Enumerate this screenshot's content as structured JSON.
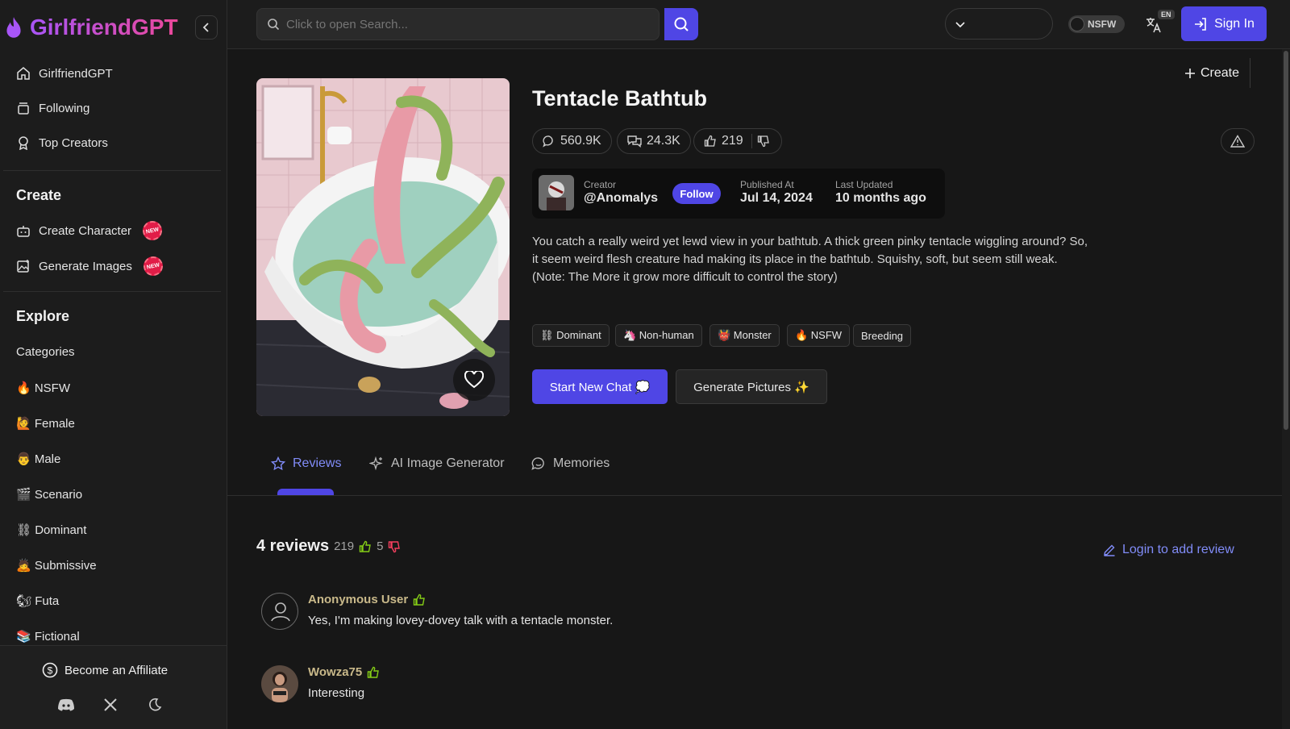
{
  "app": {
    "brand": "GirlfriendGPT"
  },
  "sidebar": {
    "nav": [
      {
        "label": "GirlfriendGPT",
        "icon": "home-icon"
      },
      {
        "label": "Following",
        "icon": "stack-icon"
      },
      {
        "label": "Top Creators",
        "icon": "award-icon"
      }
    ],
    "create_title": "Create",
    "create_items": [
      {
        "label": "Create Character",
        "badge": "NEW",
        "icon": "bot-icon"
      },
      {
        "label": "Generate Images",
        "badge": "NEW",
        "icon": "image-plus-icon"
      }
    ],
    "explore_title": "Explore",
    "explore_items": [
      {
        "label": "Categories"
      },
      {
        "label": "🔥 NSFW"
      },
      {
        "label": "🙋 Female"
      },
      {
        "label": "👨 Male"
      },
      {
        "label": "🎬 Scenario"
      },
      {
        "label": "⛓ Dominant"
      },
      {
        "label": "🙇 Submissive"
      },
      {
        "label": "🐿 Futa"
      },
      {
        "label": "📚 Fictional"
      }
    ],
    "affiliate_label": "Become an Affiliate",
    "social_icons": [
      "discord-icon",
      "x-icon",
      "moon-icon"
    ]
  },
  "topbar": {
    "search_placeholder": "Click to open Search...",
    "create_label": "Create",
    "nsfw_label": "NSFW",
    "lang_badge": "EN",
    "signin_label": "Sign In"
  },
  "character": {
    "title": "Tentacle Bathtub",
    "stats": {
      "chats": "560.9K",
      "messages": "24.3K",
      "likes": "219"
    },
    "creator_label": "Creator",
    "creator_name": "@Anomalys",
    "follow_label": "Follow",
    "published_label": "Published At",
    "published_value": "Jul 14, 2024",
    "updated_label": "Last Updated",
    "updated_value": "10 months ago",
    "description": "You catch a really weird yet lewd view in your bathtub. A thick green pinky tentacle wiggling around? So, it seem weird flesh creature had making its place in the bathtub. Squishy, soft, but seem still weak. (Note: The More it grow more difficult to control the story)",
    "tags": [
      "⛓ Dominant",
      "🦄 Non-human",
      "👹 Monster",
      "🔥 NSFW",
      "Breeding"
    ],
    "start_chat_label": "Start New Chat 💭",
    "generate_label": "Generate Pictures ✨"
  },
  "tabs": [
    {
      "label": "Reviews",
      "active": true
    },
    {
      "label": "AI Image Generator",
      "active": false
    },
    {
      "label": "Memories",
      "active": false
    }
  ],
  "reviews": {
    "title": "4 reviews",
    "likes": "219",
    "dislikes": "5",
    "login_label": "Login to add review",
    "items": [
      {
        "user": "Anonymous User",
        "text": "Yes, I'm making lovey-dovey talk with a tentacle monster."
      },
      {
        "user": "Wowza75",
        "text": "Interesting"
      }
    ]
  },
  "colors": {
    "accent": "#4f46e5",
    "link": "#818cf8",
    "background": "#171717",
    "panel": "#1c1c1c"
  }
}
